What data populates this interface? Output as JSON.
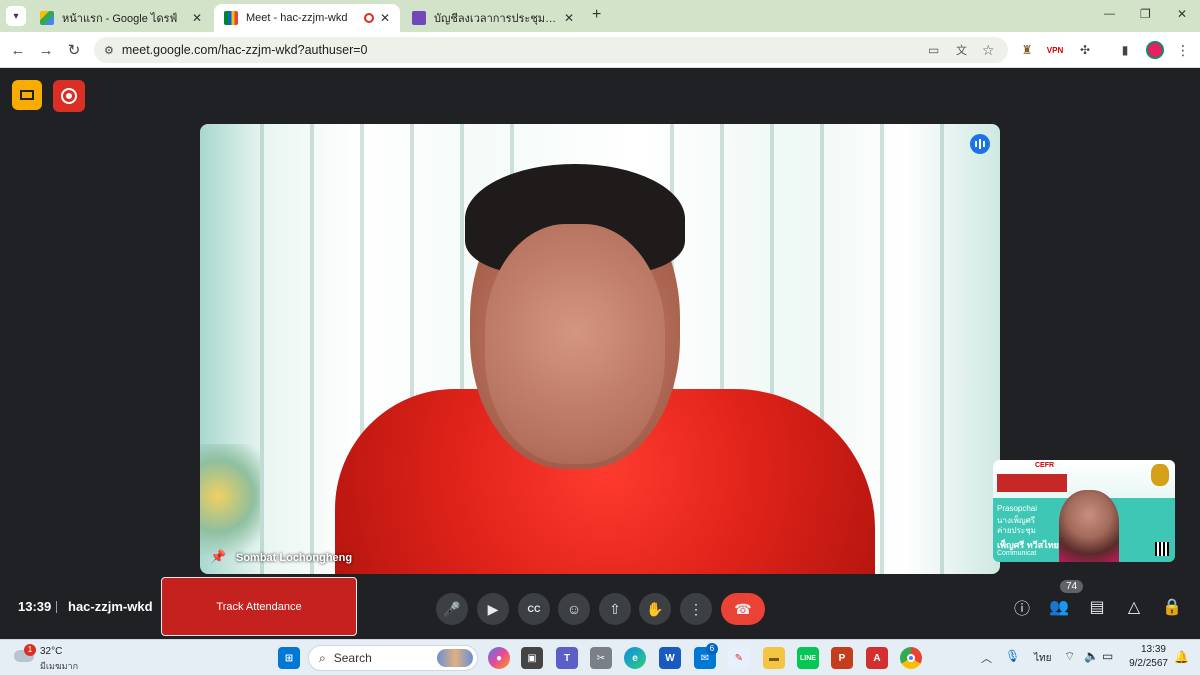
{
  "browser": {
    "tabs": [
      {
        "label": "หน้าแรก - Google ไดรฟ์",
        "icon": "google-drive-icon",
        "active": false
      },
      {
        "label": "Meet - hac-zzjm-wkd",
        "icon": "google-meet-icon",
        "active": true
      },
      {
        "label": "บัญชีลงเวลาการประชุมสอบ CEFR ปี",
        "icon": "google-forms-icon",
        "active": false
      }
    ],
    "new_tab_label": "+",
    "url": "meet.google.com/hac-zzjm-wkd?authuser=0",
    "window_controls": {
      "minimize": "—",
      "restore": "❐",
      "close": "✕"
    }
  },
  "meet": {
    "presenter_name": "Sombat Lochongheng",
    "time": "13:39",
    "meeting_code": "hac-zzjm-wkd",
    "track_attendance_label": "Track Attendance",
    "participant_count": "74",
    "thumbnail": {
      "banner_heading": "CEFR",
      "slide_line_1": "Prasopchai",
      "slide_line_2": "นางเพ็ญศรี",
      "slide_line_3": "ค่ายประชุม",
      "slide_name": "เพ็ญศรี ทวีสไทย",
      "slide_sub": "Communicat"
    },
    "colors": {
      "yellow_button": "#f9ab00",
      "red_button": "#d93025",
      "end_call": "#ea4335",
      "ctrl_button": "#3c4043",
      "track_button": "#c5221f",
      "thumbnail_bg": "#3ec7b5"
    }
  },
  "taskbar": {
    "weather_temp": "32°C",
    "weather_desc": "มีเมฆมาก",
    "weather_badge": "1",
    "search_placeholder": "Search",
    "lang": "ไทย",
    "clock_time": "13:39",
    "clock_date": "9/2/2567",
    "mail_badge": "6",
    "pinned_icons": [
      "start-icon",
      "copilot-icon",
      "file-explorer-icon",
      "teams-icon",
      "snipping-tool-icon",
      "edge-icon",
      "word-icon",
      "mail-icon",
      "paint-icon",
      "folder-icon",
      "line-icon",
      "powerpoint-icon",
      "acrobat-icon",
      "chrome-icon"
    ]
  }
}
